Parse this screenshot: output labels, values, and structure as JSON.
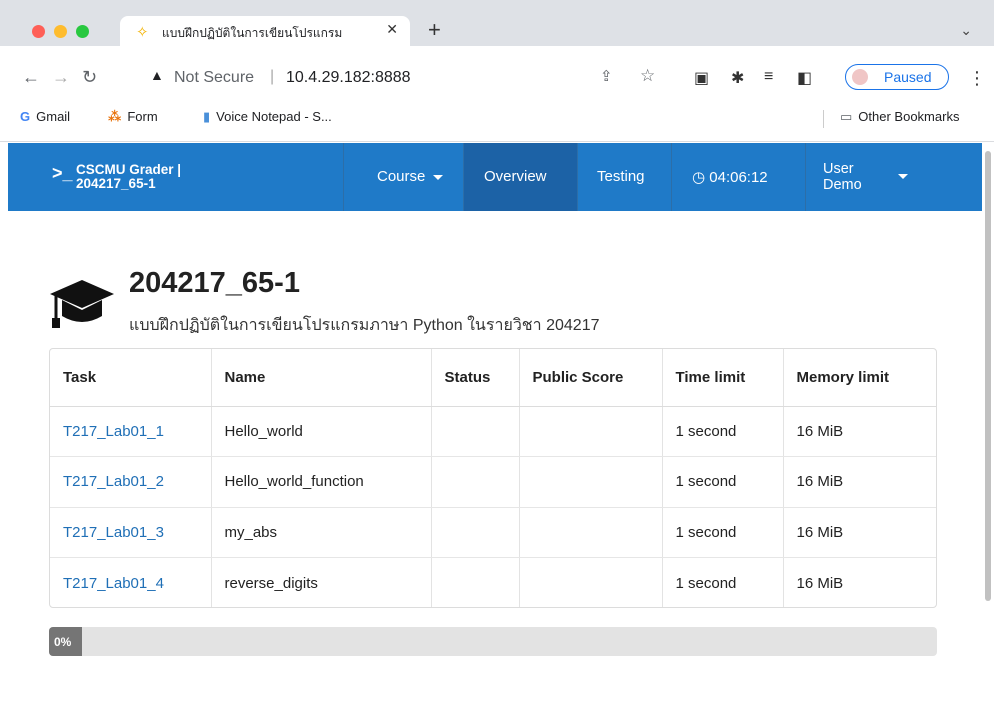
{
  "browser": {
    "tab_title": "แบบฝึกปฏิบัติในการเขียนโปรแกรม",
    "not_secure": "Not Secure",
    "url": "10.4.29.182:8888",
    "profile_status": "Paused",
    "bookmarks": [
      {
        "label": "Gmail",
        "icon": "G"
      },
      {
        "label": "Form",
        "icon": "⁂"
      },
      {
        "label": "Voice Notepad - S...",
        "icon": "🎙"
      }
    ],
    "other_bookmarks": "Other Bookmarks"
  },
  "navbar": {
    "brand_line1": "CSCMU Grader |",
    "brand_line2": "204217_65-1",
    "course": "Course",
    "overview": "Overview",
    "testing": "Testing",
    "timer": "04:06:12",
    "user_line1": "User",
    "user_line2": "Demo",
    "accent": "#1f7ac8"
  },
  "header": {
    "title": "204217_65-1",
    "subtitle": "แบบฝึกปฏิบัติในการเขียนโปรแกรมภาษา Python ในรายวิชา 204217"
  },
  "table": {
    "columns": [
      "Task",
      "Name",
      "Status",
      "Public Score",
      "Time limit",
      "Memory limit"
    ],
    "rows": [
      {
        "task": "T217_Lab01_1",
        "name": "Hello_world",
        "status": "",
        "score": "",
        "time": "1 second",
        "memory": "16 MiB"
      },
      {
        "task": "T217_Lab01_2",
        "name": "Hello_world_function",
        "status": "",
        "score": "",
        "time": "1 second",
        "memory": "16 MiB"
      },
      {
        "task": "T217_Lab01_3",
        "name": "my_abs",
        "status": "",
        "score": "",
        "time": "1 second",
        "memory": "16 MiB"
      },
      {
        "task": "T217_Lab01_4",
        "name": "reverse_digits",
        "status": "",
        "score": "",
        "time": "1 second",
        "memory": "16 MiB"
      }
    ]
  },
  "progress": {
    "label": "0%",
    "value": 0
  }
}
